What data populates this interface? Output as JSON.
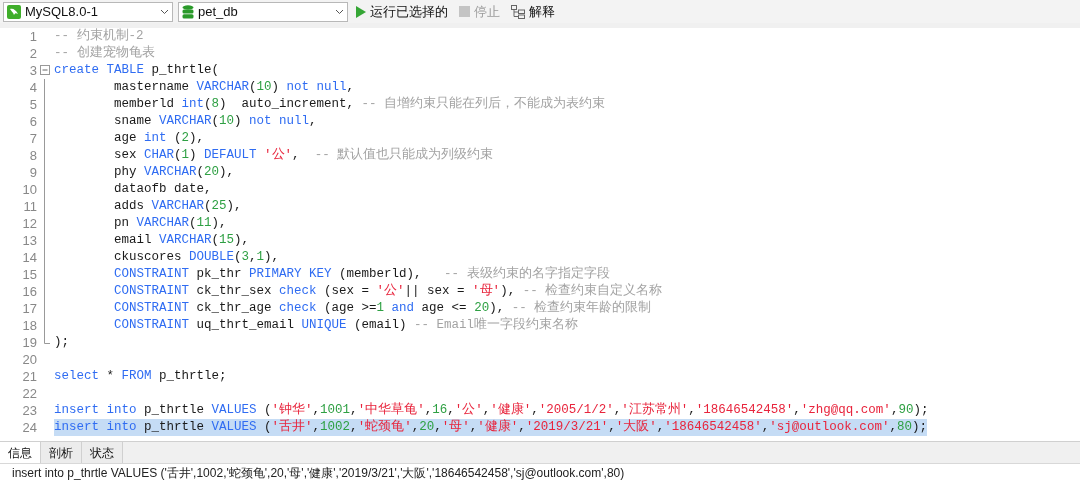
{
  "toolbar": {
    "connection": "MySQL8.0-1",
    "database": "pet_db",
    "buttons": [
      {
        "kind": "run",
        "label": "运行已选择的",
        "disabled": false
      },
      {
        "kind": "stop",
        "label": "停止",
        "disabled": true
      },
      {
        "kind": "explain",
        "label": "解释",
        "disabled": false
      }
    ]
  },
  "editor": {
    "lines": [
      {
        "number": "1",
        "tokens": [
          {
            "text": "-- 约束机制-2",
            "kind": "comment"
          }
        ]
      },
      {
        "number": "2",
        "tokens": [
          {
            "text": "-- 创建宠物龟表",
            "kind": "comment"
          }
        ]
      },
      {
        "number": "3",
        "expanded": true,
        "tokens": [
          {
            "text": "create ",
            "kind": "keyword"
          },
          {
            "text": "TABLE",
            "kind": "keyword"
          },
          {
            "text": " p_thrtle(",
            "kind": "plain"
          }
        ]
      },
      {
        "number": "4",
        "tokens": [
          {
            "text": "        mastername ",
            "kind": "plain"
          },
          {
            "text": "VARCHAR",
            "kind": "keyword"
          },
          {
            "text": "(",
            "kind": "plain"
          },
          {
            "text": "10",
            "kind": "number"
          },
          {
            "text": ") ",
            "kind": "plain"
          },
          {
            "text": "not null",
            "kind": "keyword"
          },
          {
            "text": ",",
            "kind": "plain"
          }
        ]
      },
      {
        "number": "5",
        "tokens": [
          {
            "text": "        memberld ",
            "kind": "plain"
          },
          {
            "text": "int",
            "kind": "keyword"
          },
          {
            "text": "(",
            "kind": "plain"
          },
          {
            "text": "8",
            "kind": "number"
          },
          {
            "text": ")  auto_increment, ",
            "kind": "plain"
          },
          {
            "text": "-- 自增约束只能在列后，不能成为表约束",
            "kind": "comment"
          }
        ]
      },
      {
        "number": "6",
        "tokens": [
          {
            "text": "        sname ",
            "kind": "plain"
          },
          {
            "text": "VARCHAR",
            "kind": "keyword"
          },
          {
            "text": "(",
            "kind": "plain"
          },
          {
            "text": "10",
            "kind": "number"
          },
          {
            "text": ") ",
            "kind": "plain"
          },
          {
            "text": "not null",
            "kind": "keyword"
          },
          {
            "text": ",",
            "kind": "plain"
          }
        ]
      },
      {
        "number": "7",
        "tokens": [
          {
            "text": "        age ",
            "kind": "plain"
          },
          {
            "text": "int",
            "kind": "keyword"
          },
          {
            "text": " (",
            "kind": "plain"
          },
          {
            "text": "2",
            "kind": "number"
          },
          {
            "text": "),",
            "kind": "plain"
          }
        ]
      },
      {
        "number": "8",
        "tokens": [
          {
            "text": "        sex ",
            "kind": "plain"
          },
          {
            "text": "CHAR",
            "kind": "keyword"
          },
          {
            "text": "(",
            "kind": "plain"
          },
          {
            "text": "1",
            "kind": "number"
          },
          {
            "text": ") ",
            "kind": "plain"
          },
          {
            "text": "DEFAULT ",
            "kind": "keyword"
          },
          {
            "text": "'公'",
            "kind": "string"
          },
          {
            "text": ",  ",
            "kind": "plain"
          },
          {
            "text": "-- 默认值也只能成为列级约束",
            "kind": "comment"
          }
        ]
      },
      {
        "number": "9",
        "tokens": [
          {
            "text": "        phy ",
            "kind": "plain"
          },
          {
            "text": "VARCHAR",
            "kind": "keyword"
          },
          {
            "text": "(",
            "kind": "plain"
          },
          {
            "text": "20",
            "kind": "number"
          },
          {
            "text": "),",
            "kind": "plain"
          }
        ]
      },
      {
        "number": "10",
        "tokens": [
          {
            "text": "        dataofb date,",
            "kind": "plain"
          }
        ]
      },
      {
        "number": "11",
        "tokens": [
          {
            "text": "        adds ",
            "kind": "plain"
          },
          {
            "text": "VARCHAR",
            "kind": "keyword"
          },
          {
            "text": "(",
            "kind": "plain"
          },
          {
            "text": "25",
            "kind": "number"
          },
          {
            "text": "),",
            "kind": "plain"
          }
        ]
      },
      {
        "number": "12",
        "tokens": [
          {
            "text": "        pn ",
            "kind": "plain"
          },
          {
            "text": "VARCHAR",
            "kind": "keyword"
          },
          {
            "text": "(",
            "kind": "plain"
          },
          {
            "text": "11",
            "kind": "number"
          },
          {
            "text": "),",
            "kind": "plain"
          }
        ]
      },
      {
        "number": "13",
        "tokens": [
          {
            "text": "        email ",
            "kind": "plain"
          },
          {
            "text": "VARCHAR",
            "kind": "keyword"
          },
          {
            "text": "(",
            "kind": "plain"
          },
          {
            "text": "15",
            "kind": "number"
          },
          {
            "text": "),",
            "kind": "plain"
          }
        ]
      },
      {
        "number": "14",
        "tokens": [
          {
            "text": "        ckuscores ",
            "kind": "plain"
          },
          {
            "text": "DOUBLE",
            "kind": "keyword"
          },
          {
            "text": "(",
            "kind": "plain"
          },
          {
            "text": "3",
            "kind": "number"
          },
          {
            "text": ",",
            "kind": "plain"
          },
          {
            "text": "1",
            "kind": "number"
          },
          {
            "text": "),",
            "kind": "plain"
          }
        ]
      },
      {
        "number": "15",
        "tokens": [
          {
            "text": "        CONSTRAINT",
            "kind": "keyword"
          },
          {
            "text": " pk_thr ",
            "kind": "plain"
          },
          {
            "text": "PRIMARY KEY",
            "kind": "keyword"
          },
          {
            "text": " (memberld),   ",
            "kind": "plain"
          },
          {
            "text": "-- 表级约束的名字指定字段",
            "kind": "comment"
          }
        ]
      },
      {
        "number": "16",
        "tokens": [
          {
            "text": "        CONSTRAINT",
            "kind": "keyword"
          },
          {
            "text": " ck_thr_sex ",
            "kind": "plain"
          },
          {
            "text": "check",
            "kind": "keyword"
          },
          {
            "text": " (sex = ",
            "kind": "plain"
          },
          {
            "text": "'公'",
            "kind": "string"
          },
          {
            "text": "|| sex = ",
            "kind": "plain"
          },
          {
            "text": "'母'",
            "kind": "string"
          },
          {
            "text": "), ",
            "kind": "plain"
          },
          {
            "text": "-- 检查约束自定义名称",
            "kind": "comment"
          }
        ]
      },
      {
        "number": "17",
        "tokens": [
          {
            "text": "        CONSTRAINT",
            "kind": "keyword"
          },
          {
            "text": " ck_thr_age ",
            "kind": "plain"
          },
          {
            "text": "check",
            "kind": "keyword"
          },
          {
            "text": " (age >=",
            "kind": "plain"
          },
          {
            "text": "1 ",
            "kind": "number"
          },
          {
            "text": "and",
            "kind": "keyword"
          },
          {
            "text": " age <= ",
            "kind": "plain"
          },
          {
            "text": "20",
            "kind": "number"
          },
          {
            "text": "), ",
            "kind": "plain"
          },
          {
            "text": "-- 检查约束年龄的限制",
            "kind": "comment"
          }
        ]
      },
      {
        "number": "18",
        "tokens": [
          {
            "text": "        CONSTRAINT",
            "kind": "keyword"
          },
          {
            "text": " uq_thrt_email ",
            "kind": "plain"
          },
          {
            "text": "UNIQUE",
            "kind": "keyword"
          },
          {
            "text": " (email) ",
            "kind": "plain"
          },
          {
            "text": "-- Email唯一字段约束名称",
            "kind": "comment"
          }
        ]
      },
      {
        "number": "19",
        "fold_end": true,
        "tokens": [
          {
            "text": ");",
            "kind": "plain"
          }
        ]
      },
      {
        "number": "20"
      },
      {
        "number": "21",
        "tokens": [
          {
            "text": "select",
            "kind": "keyword"
          },
          {
            "text": " * ",
            "kind": "plain"
          },
          {
            "text": "FROM",
            "kind": "keyword"
          },
          {
            "text": " p_thrtle;",
            "kind": "plain"
          }
        ]
      },
      {
        "number": "22"
      },
      {
        "number": "23",
        "tokens": [
          {
            "text": "insert into",
            "kind": "keyword"
          },
          {
            "text": " p_thrtle ",
            "kind": "plain"
          },
          {
            "text": "VALUES",
            "kind": "keyword"
          },
          {
            "text": " (",
            "kind": "plain"
          },
          {
            "text": "'钟华'",
            "kind": "string"
          },
          {
            "text": ",",
            "kind": "plain"
          },
          {
            "text": "1001",
            "kind": "number"
          },
          {
            "text": ",",
            "kind": "plain"
          },
          {
            "text": "'中华草龟'",
            "kind": "string"
          },
          {
            "text": ",",
            "kind": "plain"
          },
          {
            "text": "16",
            "kind": "number"
          },
          {
            "text": ",",
            "kind": "plain"
          },
          {
            "text": "'公'",
            "kind": "string"
          },
          {
            "text": ",",
            "kind": "plain"
          },
          {
            "text": "'健康'",
            "kind": "string"
          },
          {
            "text": ",",
            "kind": "plain"
          },
          {
            "text": "'2005/1/2'",
            "kind": "string"
          },
          {
            "text": ",",
            "kind": "plain"
          },
          {
            "text": "'江苏常州'",
            "kind": "string"
          },
          {
            "text": ",",
            "kind": "plain"
          },
          {
            "text": "'18646542458'",
            "kind": "string"
          },
          {
            "text": ",",
            "kind": "plain"
          },
          {
            "text": "'zhg@qq.com'",
            "kind": "string"
          },
          {
            "text": ",",
            "kind": "plain"
          },
          {
            "text": "90",
            "kind": "number"
          },
          {
            "text": ");",
            "kind": "plain"
          }
        ]
      },
      {
        "number": "24",
        "selected": true,
        "tokens": [
          {
            "text": "insert into",
            "kind": "keyword"
          },
          {
            "text": " p_thrtle ",
            "kind": "plain"
          },
          {
            "text": "VALUES",
            "kind": "keyword"
          },
          {
            "text": " (",
            "kind": "plain"
          },
          {
            "text": "'舌井'",
            "kind": "string"
          },
          {
            "text": ",",
            "kind": "plain"
          },
          {
            "text": "1002",
            "kind": "number"
          },
          {
            "text": ",",
            "kind": "plain"
          },
          {
            "text": "'蛇颈龟'",
            "kind": "string"
          },
          {
            "text": ",",
            "kind": "plain"
          },
          {
            "text": "20",
            "kind": "number"
          },
          {
            "text": ",",
            "kind": "plain"
          },
          {
            "text": "'母'",
            "kind": "string"
          },
          {
            "text": ",",
            "kind": "plain"
          },
          {
            "text": "'健康'",
            "kind": "string"
          },
          {
            "text": ",",
            "kind": "plain"
          },
          {
            "text": "'2019/3/21'",
            "kind": "string"
          },
          {
            "text": ",",
            "kind": "plain"
          },
          {
            "text": "'大阪'",
            "kind": "string"
          },
          {
            "text": ",",
            "kind": "plain"
          },
          {
            "text": "'18646542458'",
            "kind": "string"
          },
          {
            "text": ",",
            "kind": "plain"
          },
          {
            "text": "'sj@outlook.com'",
            "kind": "string"
          },
          {
            "text": ",",
            "kind": "plain"
          },
          {
            "text": "80",
            "kind": "number"
          },
          {
            "text": ");",
            "kind": "plain"
          }
        ]
      }
    ]
  },
  "result_tabs": [
    {
      "label": "信息",
      "selected": true
    },
    {
      "label": "剖析",
      "selected": false
    },
    {
      "label": "状态",
      "selected": false
    }
  ],
  "message": "insert into p_thrtle VALUES ('舌井',1002,'蛇颈龟',20,'母','健康','2019/3/21','大阪','18646542458','sj@outlook.com',80)"
}
